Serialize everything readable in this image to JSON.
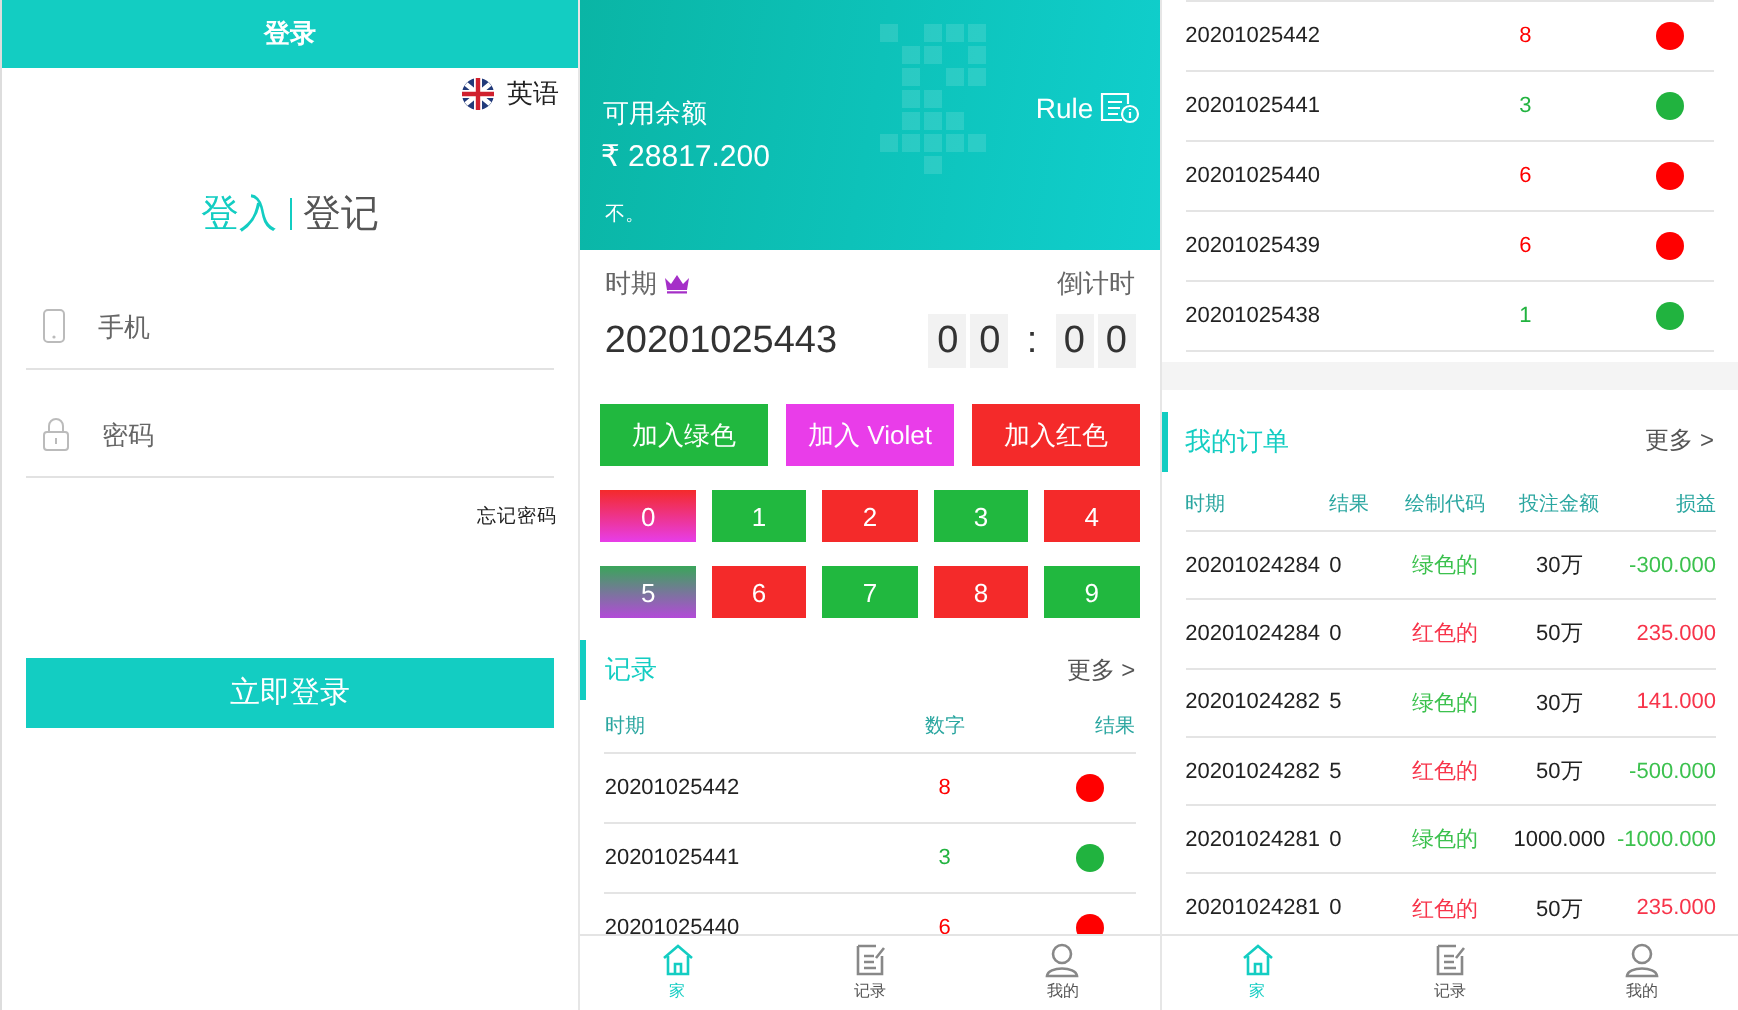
{
  "login": {
    "title": "登录",
    "language": "英语",
    "tabs": [
      {
        "label": "登入",
        "selected": true
      },
      {
        "label": "登记",
        "selected": false
      }
    ],
    "fields": [
      {
        "kind": "phone",
        "placeholder": "手机"
      },
      {
        "kind": "password",
        "placeholder": "密码"
      }
    ],
    "forgot_link": "忘记密码",
    "submit_button": "立即登录"
  },
  "game": {
    "balance_label": "可用余额",
    "balance": "₹ 28817.200",
    "note": "不。",
    "rule_link": "Rule",
    "period_label": "时期",
    "countdown_label": "倒计时",
    "period": "20201025443",
    "countdown_digits": [
      "0",
      "0",
      "0",
      "0"
    ],
    "countdown_separator": ":",
    "join_buttons": [
      {
        "label": "加入绿色",
        "color": "#21b83f"
      },
      {
        "label": "加入 Violet",
        "color": "#e93de9"
      },
      {
        "label": "加入红色",
        "color": "#f42a2a"
      }
    ],
    "numbers": [
      {
        "label": "0",
        "kind": "red-violet"
      },
      {
        "label": "1",
        "kind": "green"
      },
      {
        "label": "2",
        "kind": "red"
      },
      {
        "label": "3",
        "kind": "green"
      },
      {
        "label": "4",
        "kind": "red"
      },
      {
        "label": "5",
        "kind": "green-violet"
      },
      {
        "label": "6",
        "kind": "red"
      },
      {
        "label": "7",
        "kind": "green"
      },
      {
        "label": "8",
        "kind": "red"
      },
      {
        "label": "9",
        "kind": "green"
      }
    ],
    "records": {
      "title": "记录",
      "more_link": "更多 >",
      "columns": [
        "时期",
        "数字",
        "结果"
      ],
      "rows": [
        {
          "period": "20201025442",
          "number": "8",
          "color": "#ff0000"
        },
        {
          "period": "20201025441",
          "number": "3",
          "color": "#21b33f"
        },
        {
          "period": "20201025440",
          "number": "6",
          "color": "#ff0000"
        }
      ]
    },
    "nav": [
      {
        "kind": "home",
        "label": "家",
        "selected": true
      },
      {
        "kind": "records",
        "label": "记录",
        "selected": false
      },
      {
        "kind": "profile",
        "label": "我的",
        "selected": false
      }
    ]
  },
  "history": {
    "records": [
      {
        "period": "20201025442",
        "number": "8",
        "color": "#ff0000"
      },
      {
        "period": "20201025441",
        "number": "3",
        "color": "#21b33f"
      },
      {
        "period": "20201025440",
        "number": "6",
        "color": "#ff0000"
      },
      {
        "period": "20201025439",
        "number": "6",
        "color": "#ff0000"
      },
      {
        "period": "20201025438",
        "number": "1",
        "color": "#21b33f"
      }
    ],
    "orders": {
      "title": "我的订单",
      "more_link": "更多 >",
      "columns": [
        "时期",
        "结果",
        "绘制代码",
        "投注金额",
        "损益"
      ],
      "rows": [
        {
          "period": "20201024284",
          "result": "0",
          "code": {
            "text": "绿色的",
            "color": "#3cc14e"
          },
          "amount": "30万",
          "profit": {
            "text": "-300.000",
            "color": "#3cc14e"
          }
        },
        {
          "period": "20201024284",
          "result": "0",
          "code": {
            "text": "红色的",
            "color": "#f7344a"
          },
          "amount": "50万",
          "profit": {
            "text": "235.000",
            "color": "#f7344a"
          }
        },
        {
          "period": "20201024282",
          "result": "5",
          "code": {
            "text": "绿色的",
            "color": "#3cc14e"
          },
          "amount": "30万",
          "profit": {
            "text": "141.000",
            "color": "#f7344a"
          }
        },
        {
          "period": "20201024282",
          "result": "5",
          "code": {
            "text": "红色的",
            "color": "#f7344a"
          },
          "amount": "50万",
          "profit": {
            "text": "-500.000",
            "color": "#3cc14e"
          }
        },
        {
          "period": "20201024281",
          "result": "0",
          "code": {
            "text": "绿色的",
            "color": "#3cc14e"
          },
          "amount": "1000.000",
          "profit": {
            "text": "-1000.000",
            "color": "#3cc14e"
          }
        },
        {
          "period": "20201024281",
          "result": "0",
          "code": {
            "text": "红色的",
            "color": "#f7344a"
          },
          "amount": "50万",
          "profit": {
            "text": "235.000",
            "color": "#f7344a"
          }
        }
      ]
    },
    "nav": [
      {
        "kind": "home",
        "label": "家",
        "selected": true
      },
      {
        "kind": "records",
        "label": "记录",
        "selected": false
      },
      {
        "kind": "profile",
        "label": "我的",
        "selected": false
      }
    ]
  }
}
